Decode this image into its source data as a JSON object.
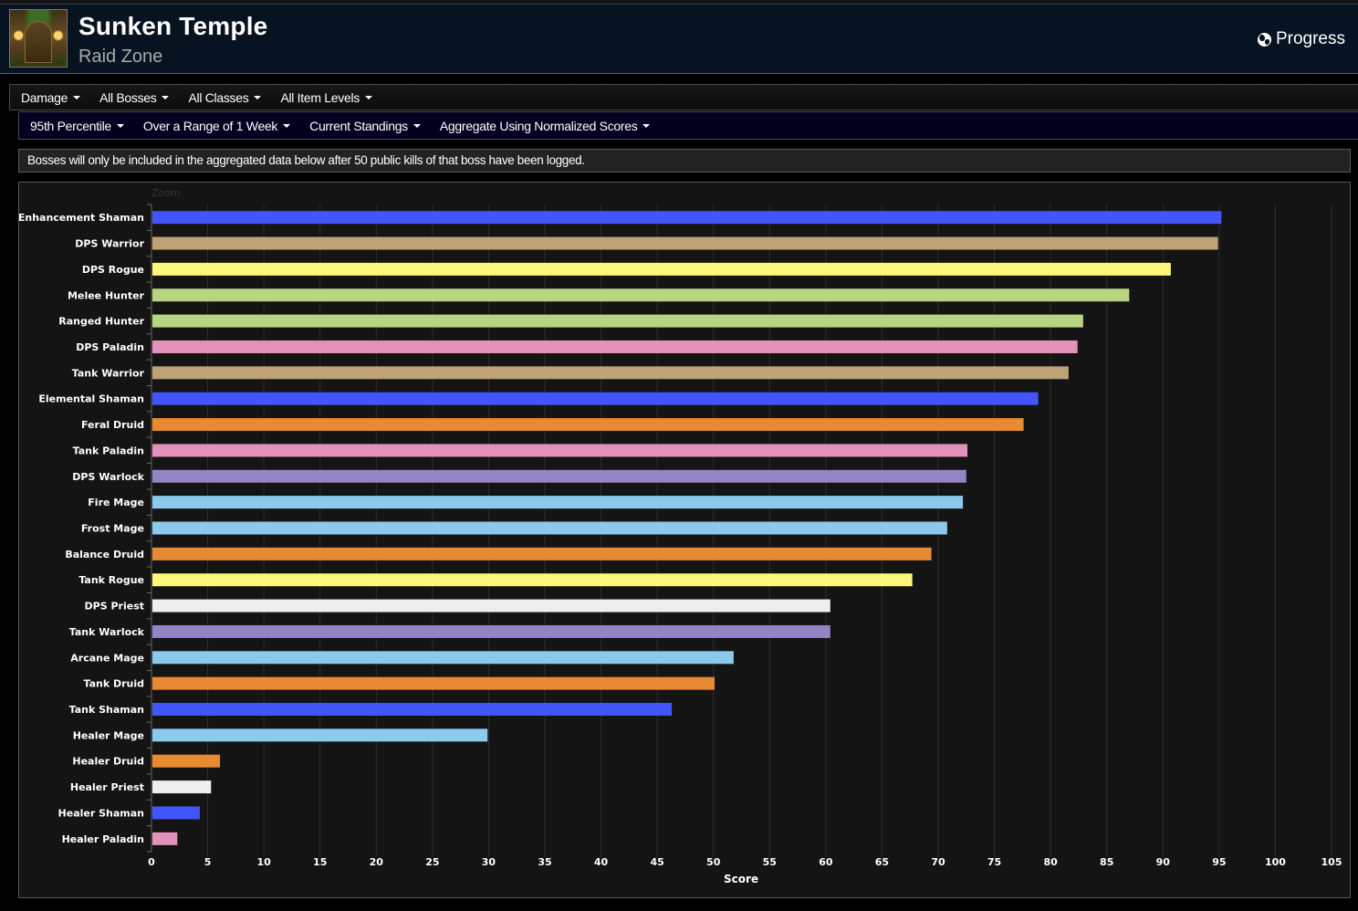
{
  "header": {
    "title": "Sunken Temple",
    "subtitle": "Raid Zone",
    "progress_label": "Progress",
    "zone_icon": "sunken-temple-zone-icon",
    "progress_icon": "globe-icon"
  },
  "filters_row1": [
    {
      "label": "Damage"
    },
    {
      "label": "All Bosses"
    },
    {
      "label": "All Classes"
    },
    {
      "label": "All Item Levels"
    }
  ],
  "filters_row2": [
    {
      "label": "95th Percentile"
    },
    {
      "label": "Over a Range of 1 Week"
    },
    {
      "label": "Current Standings"
    },
    {
      "label": "Aggregate Using Normalized Scores"
    }
  ],
  "notice": "Bosses will only be included in the aggregated data below after 50 public kills of that boss have been logged.",
  "chart_data": {
    "type": "bar",
    "orientation": "horizontal",
    "zoom_label": "Zoom",
    "title": "",
    "xlabel": "Score",
    "ylabel": "",
    "xlim": [
      0,
      105
    ],
    "x_ticks": [
      0,
      5,
      10,
      15,
      20,
      25,
      30,
      35,
      40,
      45,
      50,
      55,
      60,
      65,
      70,
      75,
      80,
      85,
      90,
      95,
      100,
      105
    ],
    "grid": true,
    "legend": "none",
    "categories": [
      "Enhancement Shaman",
      "DPS Warrior",
      "DPS Rogue",
      "Melee Hunter",
      "Ranged Hunter",
      "DPS Paladin",
      "Tank Warrior",
      "Elemental Shaman",
      "Feral Druid",
      "Tank Paladin",
      "DPS Warlock",
      "Fire Mage",
      "Frost Mage",
      "Balance Druid",
      "Tank Rogue",
      "DPS Priest",
      "Tank Warlock",
      "Arcane Mage",
      "Tank Druid",
      "Tank Shaman",
      "Healer Mage",
      "Healer Druid",
      "Healer Priest",
      "Healer Shaman",
      "Healer Paladin"
    ],
    "values": [
      95.2,
      94.9,
      90.7,
      87.0,
      82.9,
      82.4,
      81.6,
      78.9,
      77.6,
      72.6,
      72.5,
      72.2,
      70.8,
      69.4,
      67.7,
      60.4,
      60.4,
      51.8,
      50.1,
      46.3,
      29.9,
      6.1,
      5.3,
      4.3,
      2.3
    ],
    "colors": [
      "#4155fa",
      "#bea276",
      "#fbf77a",
      "#b8d583",
      "#b8d583",
      "#e292ba",
      "#bea276",
      "#4155fa",
      "#e88a33",
      "#e292ba",
      "#9384c6",
      "#8bc9ed",
      "#8bc9ed",
      "#e88a33",
      "#fbf77a",
      "#eeeeee",
      "#9384c6",
      "#8bc9ed",
      "#e88a33",
      "#4155fa",
      "#8bc9ed",
      "#e88a33",
      "#eeeeee",
      "#4155fa",
      "#e292ba"
    ]
  }
}
